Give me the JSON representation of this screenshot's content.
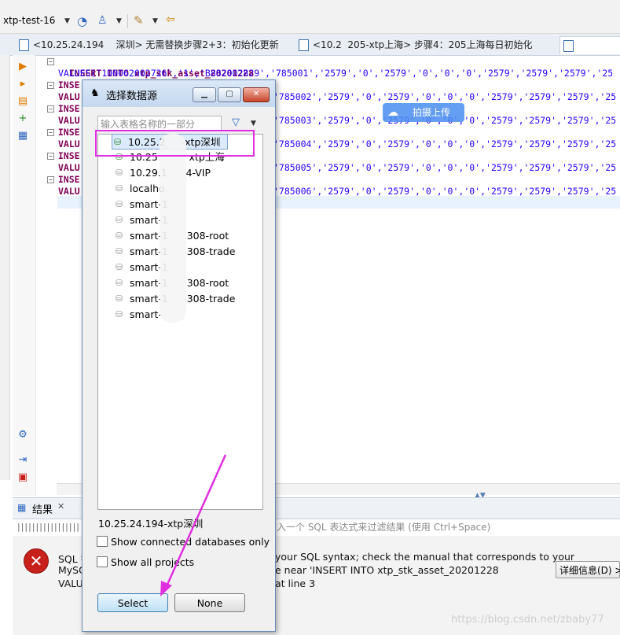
{
  "toolbar": {
    "connection": "xtp-test-16",
    "icons": [
      "dropdown-icon",
      "dashboard-icon",
      "transaction-icon",
      "wand-icon",
      "back-icon"
    ]
  },
  "tabs": [
    {
      "label": "<10.25.24.194",
      "suffix": "深圳> 无需替换步骤2+3：初始化更新"
    },
    {
      "label": "<10.2",
      "suffix": "205-xtp上海> 步骤4：205上海每日初始化"
    },
    {
      "label": ""
    }
  ],
  "sql": {
    "insert_line": "INSERT INTO xtp_stk_asset_20201228",
    "values_first": "VALUES('100062002726','1','B882002829','785001','2579','0','2579','0','0','0','2579','2579','2579','25",
    "values_ids": [
      "'785002'",
      "'785003'",
      "'785004'",
      "'785005'",
      "'785006'"
    ],
    "row_tail": ",'2579','0','2579','0','0','0','2579','2579','2579','25",
    "ins_prefix": "INSE",
    "val_prefix": "VALU"
  },
  "badge": {
    "label": "拍摄上传"
  },
  "dialog": {
    "title": "选择数据源",
    "search_placeholder": "输入表格名称的一部分",
    "items": [
      {
        "label": "10.25.24.194-xtp深圳",
        "connected": true
      },
      {
        "label": "10.25.24.205-xtp上海",
        "connected": true
      },
      {
        "label": "10.29.1.4-VIP",
        "connected": false
      },
      {
        "label": "localhost",
        "connected": false
      },
      {
        "label": "smart-1",
        "connected": false
      },
      {
        "label": "smart-1",
        "connected": false
      },
      {
        "label": "smart-1 3308-root",
        "connected": false
      },
      {
        "label": "smart-1 3308-trade",
        "connected": false
      },
      {
        "label": "smart-1",
        "connected": false
      },
      {
        "label": "smart-1 3308-root",
        "connected": false
      },
      {
        "label": "smart-1 3308-trade",
        "connected": false
      },
      {
        "label": "smart-1",
        "connected": false
      }
    ],
    "items_visible": [
      "10.25.2",
      "10.25",
      "10.29.1",
      "localho",
      "smart-1",
      "smart-1",
      "smart-1",
      "smart-1",
      "smart-1",
      "smart-1",
      "smart-1",
      "smart-"
    ],
    "items_suffix": [
      "-xtp深圳",
      "xtp上海",
      "4-VIP",
      "",
      "",
      "",
      "308-root",
      "308-trade",
      "",
      "308-root",
      "308-trade",
      ""
    ],
    "selected_path": "10.25.24.194-xtp深圳",
    "show_connected_label": "Show connected databases only",
    "show_all_projects_label": "Show all projects",
    "select_label": "Select",
    "none_label": "None"
  },
  "results": {
    "tab_label": "结果",
    "filter_placeholder": "输入一个 SQL 表达式来过滤结果 (使用 Ctrl+Space)",
    "error_lines": [
      "SQL 错",
      "MySQ",
      "VALU"
    ],
    "error_right": [
      "your SQL syntax; check the manual that corresponds to your",
      "e near 'INSERT INTO xtp_stk_asset_20201228",
      "at line 3"
    ],
    "details_label": "详细信息(D) >"
  },
  "watermark": "https://blog.csdn.net/zbaby77",
  "colors": {
    "highlight": "#e02ee0",
    "keyword": "#7f0055",
    "string": "#2a00ff",
    "error": "#c8201a"
  }
}
